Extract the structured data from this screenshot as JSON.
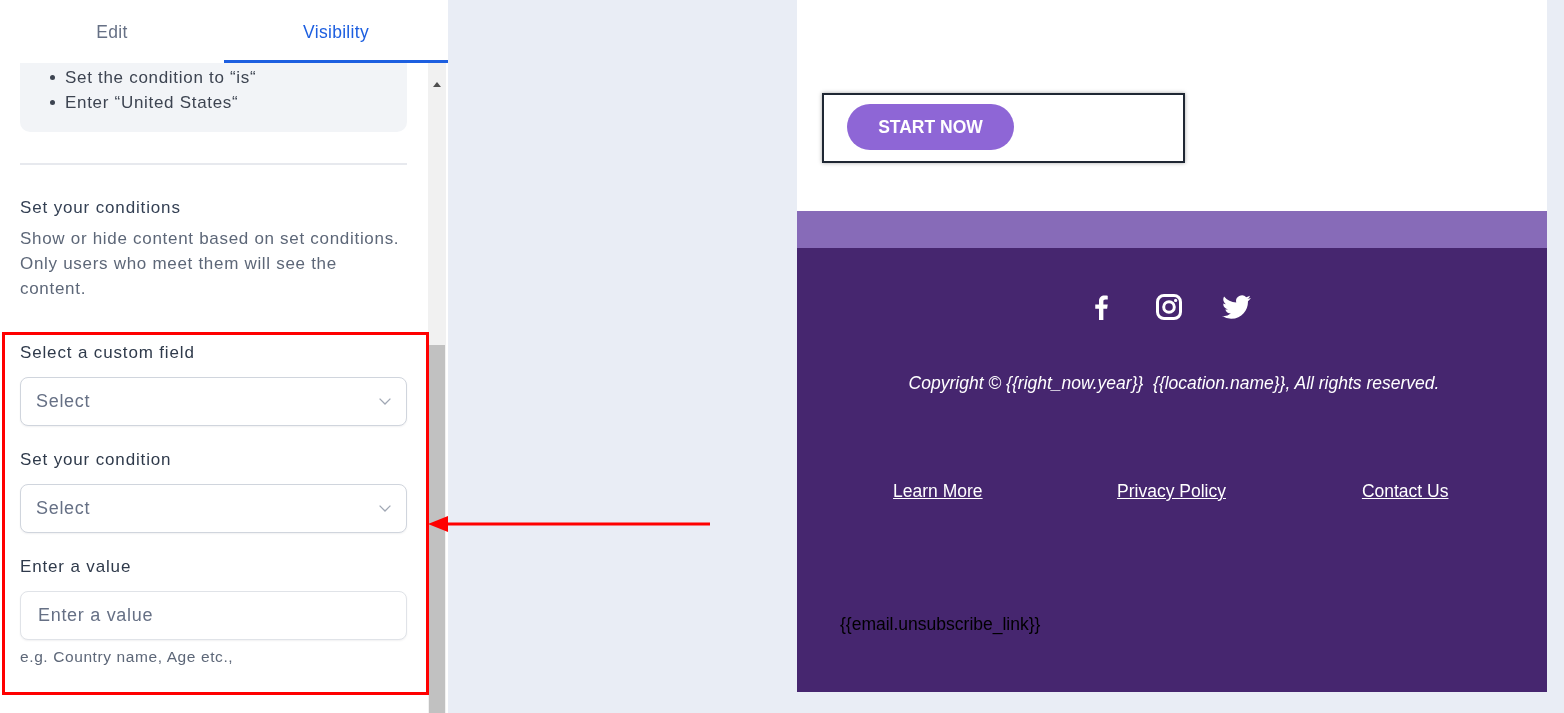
{
  "sidebar": {
    "tabs": [
      {
        "label": "Edit",
        "selected": false
      },
      {
        "label": "Visibility",
        "selected": true
      }
    ],
    "instructions": [
      "Set the condition to “is“",
      "Enter “United States“"
    ],
    "section": {
      "title": "Set your conditions",
      "description": "Show or hide content based on set conditions. Only users who meet them will see the content."
    },
    "fields": [
      {
        "kind": "select",
        "label": "Select a custom field",
        "placeholder": "Select"
      },
      {
        "kind": "select",
        "label": "Set your condition",
        "placeholder": "Select"
      },
      {
        "kind": "input",
        "label": "Enter a value",
        "placeholder": "Enter a value",
        "hint": "e.g. Country name, Age etc.,"
      }
    ]
  },
  "email_preview": {
    "button": "START NOW",
    "copyright": "Copyright © {{right_now.year}}  {{location.name}}, All rights reserved.",
    "footer_links": [
      "Learn More",
      "Privacy Policy",
      "Contact Us"
    ],
    "unsubscribe": "{{email.unsubscribe_link}}"
  }
}
